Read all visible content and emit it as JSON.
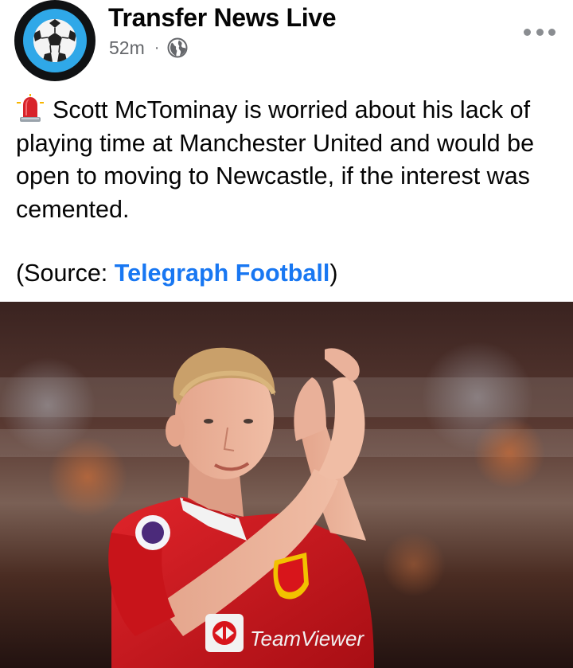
{
  "post": {
    "page_name": "Transfer News Live",
    "timestamp": "52m",
    "separator": "·",
    "audience_icon": "globe-icon",
    "more_icon": "more-options-icon",
    "alert_icon": "police-siren-emoji",
    "text": "Scott McTominay is worried about his lack of playing time at Manchester United and would be open to moving to Newcastle, if the interest was cemented.",
    "source_prefix": "(Source: ",
    "source_link": "Telegraph Football",
    "source_suffix": ")",
    "photo": {
      "subject_icon": "player-applauding-photo",
      "shirt_sponsor_text": "TeamViewer"
    }
  },
  "colors": {
    "link": "#1877f2",
    "avatar_ring": "#2fa8e8",
    "shirt_red": "#d8151b",
    "meta_grey": "#65676b"
  }
}
